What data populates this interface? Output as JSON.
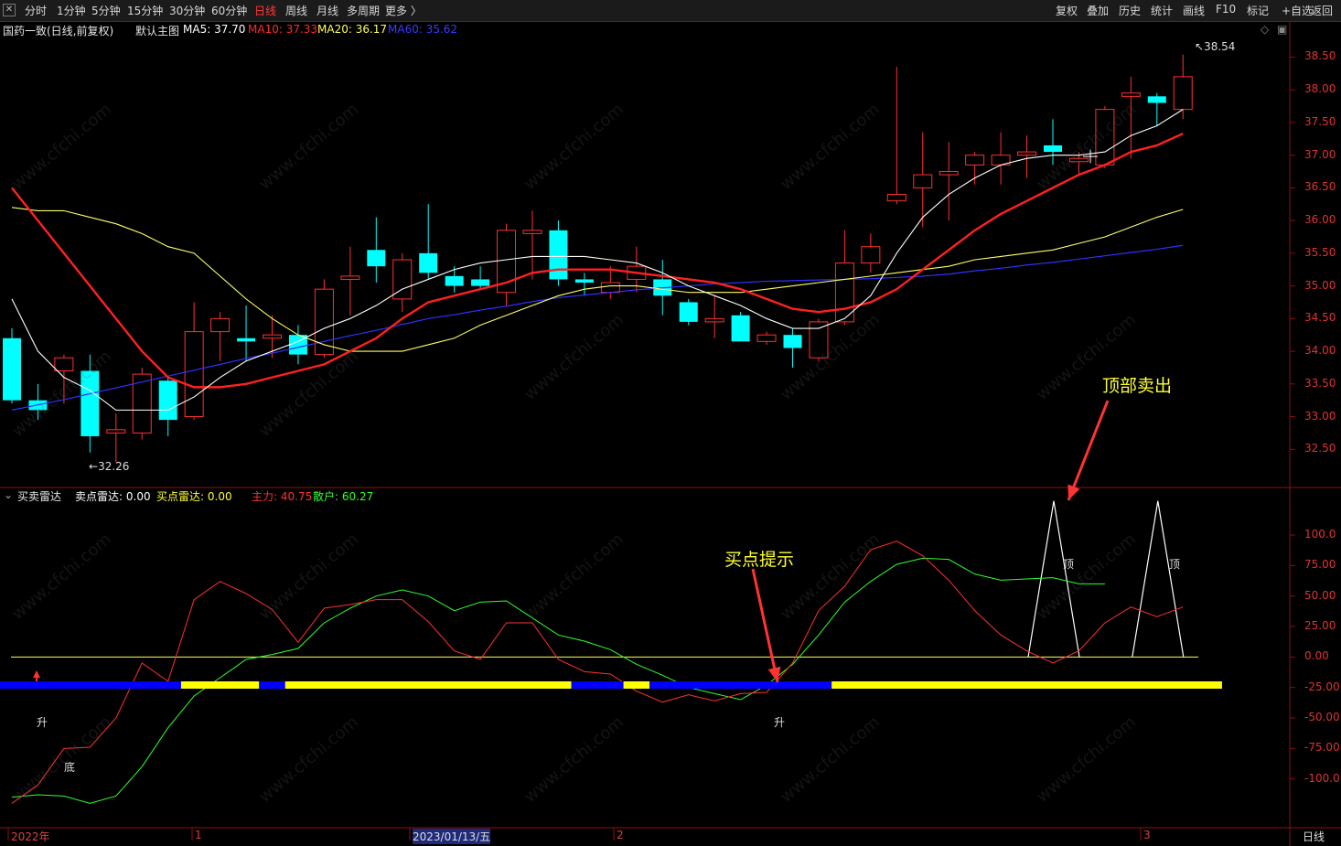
{
  "toolbar": {
    "left": [
      "分时",
      "1分钟",
      "5分钟",
      "15分钟",
      "30分钟",
      "60分钟",
      "日线",
      "周线",
      "月线",
      "多周期",
      "更多 〉"
    ],
    "active": "日线",
    "right": [
      "复权",
      "叠加",
      "历史",
      "统计",
      "画线",
      "F10",
      "标记",
      "+自选",
      "返回"
    ]
  },
  "main_header": {
    "title": "国药一致(日线,前复权)",
    "template": "默认主图",
    "ma5_label": "MA5:",
    "ma5_value": "37.70",
    "ma10_label": "MA10:",
    "ma10_value": "37.33",
    "ma20_label": "MA20:",
    "ma20_value": "36.17",
    "ma60_label": "MA60:",
    "ma60_value": "35.62"
  },
  "sub_header": {
    "title": "买卖雷达",
    "sell_label": "卖点雷达:",
    "sell_value": "0.00",
    "buy_label": "买点雷达:",
    "buy_value": "0.00",
    "main_label": "主力:",
    "main_value": "40.75",
    "retail_label": "散户:",
    "retail_value": "60.27"
  },
  "price_axis": [
    "38.50",
    "38.00",
    "37.50",
    "37.00",
    "36.50",
    "36.00",
    "35.50",
    "35.00",
    "34.50",
    "34.00",
    "33.50",
    "33.00",
    "32.50"
  ],
  "osc_axis": [
    "100.0",
    "75.00",
    "50.00",
    "25.00",
    "0.00",
    "-25.00",
    "-50.00",
    "-75.00",
    "-100.0"
  ],
  "x_axis": [
    "2022年",
    "1",
    "2023/01/13/五",
    "2",
    "3"
  ],
  "period_label": "日线",
  "marks": {
    "high": "38.54",
    "low": "32.26",
    "rise": "升",
    "bottom": "底",
    "top": "顶"
  },
  "annotations": {
    "buy_hint": "买点提示",
    "sell_hint": "顶部卖出"
  },
  "watermark": "www.cfchi.com",
  "colors": {
    "up": "#ff3030",
    "down": "#00ffff",
    "ma5": "#ffffff",
    "ma10": "#ff2020",
    "ma20": "#ffff66",
    "ma60": "#3030ff",
    "main": "#ff3030",
    "retail": "#30ff30",
    "buy_band": "#ffff00",
    "sell_band": "#0000ff",
    "annot": "#ffff33"
  },
  "chart_data": {
    "type": "candlestick",
    "candles": [
      {
        "o": 34.2,
        "h": 34.35,
        "l": 33.2,
        "c": 33.25
      },
      {
        "o": 33.25,
        "h": 33.5,
        "l": 32.95,
        "c": 33.1
      },
      {
        "o": 33.7,
        "h": 33.95,
        "l": 33.2,
        "c": 33.9
      },
      {
        "o": 33.7,
        "h": 33.95,
        "l": 32.45,
        "c": 32.7
      },
      {
        "o": 32.75,
        "h": 33.05,
        "l": 32.3,
        "c": 32.8
      },
      {
        "o": 32.75,
        "h": 33.75,
        "l": 32.65,
        "c": 33.65
      },
      {
        "o": 33.55,
        "h": 33.6,
        "l": 32.7,
        "c": 32.95
      },
      {
        "o": 33.0,
        "h": 34.75,
        "l": 32.95,
        "c": 34.3
      },
      {
        "o": 34.3,
        "h": 34.6,
        "l": 33.85,
        "c": 34.5
      },
      {
        "o": 34.2,
        "h": 34.7,
        "l": 33.85,
        "c": 34.15
      },
      {
        "o": 34.2,
        "h": 34.55,
        "l": 33.9,
        "c": 34.25
      },
      {
        "o": 34.25,
        "h": 34.4,
        "l": 33.8,
        "c": 33.95
      },
      {
        "o": 33.95,
        "h": 35.1,
        "l": 33.9,
        "c": 34.95
      },
      {
        "o": 35.1,
        "h": 35.6,
        "l": 34.55,
        "c": 35.15
      },
      {
        "o": 35.55,
        "h": 36.05,
        "l": 35.05,
        "c": 35.3
      },
      {
        "o": 34.8,
        "h": 35.5,
        "l": 34.6,
        "c": 35.4
      },
      {
        "o": 35.5,
        "h": 36.25,
        "l": 35.1,
        "c": 35.2
      },
      {
        "o": 35.15,
        "h": 35.3,
        "l": 34.9,
        "c": 35.0
      },
      {
        "o": 35.1,
        "h": 35.3,
        "l": 34.95,
        "c": 35.0
      },
      {
        "o": 34.9,
        "h": 35.95,
        "l": 34.7,
        "c": 35.85
      },
      {
        "o": 35.8,
        "h": 36.15,
        "l": 35.1,
        "c": 35.85
      },
      {
        "o": 35.85,
        "h": 36.0,
        "l": 35.0,
        "c": 35.1
      },
      {
        "o": 35.1,
        "h": 35.2,
        "l": 34.85,
        "c": 35.05
      },
      {
        "o": 34.9,
        "h": 35.3,
        "l": 34.8,
        "c": 35.05
      },
      {
        "o": 35.1,
        "h": 35.6,
        "l": 34.9,
        "c": 35.3
      },
      {
        "o": 35.1,
        "h": 35.4,
        "l": 34.55,
        "c": 34.85
      },
      {
        "o": 34.75,
        "h": 34.8,
        "l": 34.4,
        "c": 34.45
      },
      {
        "o": 34.45,
        "h": 34.85,
        "l": 34.2,
        "c": 34.5
      },
      {
        "o": 34.55,
        "h": 34.6,
        "l": 34.15,
        "c": 34.15
      },
      {
        "o": 34.15,
        "h": 34.3,
        "l": 34.1,
        "c": 34.25
      },
      {
        "o": 34.25,
        "h": 34.35,
        "l": 33.75,
        "c": 34.05
      },
      {
        "o": 33.9,
        "h": 34.5,
        "l": 33.85,
        "c": 34.45
      },
      {
        "o": 34.45,
        "h": 35.85,
        "l": 34.4,
        "c": 35.35
      },
      {
        "o": 35.35,
        "h": 35.8,
        "l": 35.2,
        "c": 35.6
      },
      {
        "o": 36.3,
        "h": 38.35,
        "l": 36.25,
        "c": 36.4
      },
      {
        "o": 36.5,
        "h": 37.35,
        "l": 35.9,
        "c": 36.7
      },
      {
        "o": 36.7,
        "h": 37.2,
        "l": 36.0,
        "c": 36.75
      },
      {
        "o": 36.85,
        "h": 37.05,
        "l": 36.55,
        "c": 37.0
      },
      {
        "o": 36.85,
        "h": 37.35,
        "l": 36.55,
        "c": 37.0
      },
      {
        "o": 37.0,
        "h": 37.3,
        "l": 36.65,
        "c": 37.05
      },
      {
        "o": 37.15,
        "h": 37.55,
        "l": 36.85,
        "c": 37.05
      },
      {
        "o": 36.9,
        "h": 37.05,
        "l": 36.7,
        "c": 36.95
      },
      {
        "o": 36.85,
        "h": 37.75,
        "l": 36.8,
        "c": 37.7
      },
      {
        "o": 37.9,
        "h": 38.2,
        "l": 36.95,
        "c": 37.95
      },
      {
        "o": 37.9,
        "h": 37.95,
        "l": 37.45,
        "c": 37.8
      },
      {
        "o": 37.7,
        "h": 38.54,
        "l": 37.55,
        "c": 38.2
      }
    ],
    "ma5": [
      34.8,
      34.0,
      33.6,
      33.4,
      33.1,
      33.1,
      33.1,
      33.3,
      33.6,
      33.85,
      34.0,
      34.15,
      34.35,
      34.5,
      34.7,
      34.95,
      35.1,
      35.25,
      35.35,
      35.4,
      35.45,
      35.45,
      35.45,
      35.4,
      35.35,
      35.2,
      35.0,
      34.85,
      34.7,
      34.5,
      34.35,
      34.35,
      34.5,
      34.85,
      35.5,
      36.05,
      36.4,
      36.65,
      36.85,
      36.95,
      37.0,
      37.0,
      37.05,
      37.3,
      37.45,
      37.7
    ],
    "ma10": [
      36.5,
      36.0,
      35.5,
      35.0,
      34.5,
      34.0,
      33.6,
      33.45,
      33.45,
      33.5,
      33.6,
      33.7,
      33.8,
      34.0,
      34.2,
      34.5,
      34.75,
      34.85,
      34.95,
      35.05,
      35.2,
      35.25,
      35.25,
      35.25,
      35.2,
      35.15,
      35.1,
      35.05,
      34.95,
      34.8,
      34.65,
      34.6,
      34.65,
      34.75,
      34.95,
      35.25,
      35.55,
      35.85,
      36.1,
      36.3,
      36.5,
      36.7,
      36.85,
      37.05,
      37.15,
      37.33
    ],
    "ma20": [
      36.2,
      36.15,
      36.15,
      36.05,
      35.95,
      35.8,
      35.6,
      35.5,
      35.15,
      34.8,
      34.5,
      34.25,
      34.1,
      34.0,
      34.0,
      34.0,
      34.1,
      34.2,
      34.4,
      34.55,
      34.7,
      34.85,
      34.95,
      35.0,
      35.0,
      34.95,
      34.9,
      34.9,
      34.9,
      34.95,
      35.0,
      35.05,
      35.1,
      35.15,
      35.2,
      35.25,
      35.3,
      35.4,
      35.45,
      35.5,
      35.55,
      35.65,
      35.75,
      35.9,
      36.05,
      36.17
    ],
    "ma60": [
      33.1,
      33.18,
      33.26,
      33.35,
      33.44,
      33.53,
      33.62,
      33.71,
      33.8,
      33.89,
      33.97,
      34.06,
      34.15,
      34.24,
      34.32,
      34.41,
      34.5,
      34.56,
      34.63,
      34.69,
      34.76,
      34.82,
      34.86,
      34.9,
      34.94,
      34.97,
      35.0,
      35.03,
      35.05,
      35.07,
      35.08,
      35.09,
      35.1,
      35.11,
      35.13,
      35.15,
      35.18,
      35.23,
      35.27,
      35.32,
      35.36,
      35.41,
      35.46,
      35.51,
      35.56,
      35.62
    ],
    "main_line": [
      -120,
      -105,
      -75,
      -74,
      -50,
      -5,
      -20,
      47,
      62,
      52,
      39,
      12,
      40,
      43,
      47,
      47,
      29,
      5,
      -2,
      28,
      28,
      -2,
      -12,
      -14,
      -28,
      -37,
      -31,
      -36,
      -30,
      -29,
      -5,
      38,
      58,
      88,
      95,
      83,
      63,
      38,
      18,
      5,
      -5,
      5,
      28,
      41,
      33,
      41
    ],
    "retail_line": [
      -115,
      -113,
      -114,
      -120,
      -114,
      -90,
      -58,
      -32,
      -17,
      -2,
      2,
      7,
      28,
      40,
      50,
      55,
      50,
      38,
      45,
      46,
      32,
      18,
      13,
      6,
      -6,
      -15,
      -25,
      -30,
      -35,
      -23,
      -6,
      18,
      45,
      62,
      76,
      81,
      80,
      68,
      63,
      64,
      65,
      60,
      60
    ],
    "top_signal_index": [
      40,
      44
    ],
    "buy_band_segments": [
      {
        "from": 0,
        "to": 6,
        "state": "sell"
      },
      {
        "from": 7,
        "to": 9,
        "state": "buy"
      },
      {
        "from": 10,
        "to": 10,
        "state": "sell"
      },
      {
        "from": 11,
        "to": 21,
        "state": "buy"
      },
      {
        "from": 22,
        "to": 23,
        "state": "sell"
      },
      {
        "from": 24,
        "to": 24,
        "state": "buy"
      },
      {
        "from": 25,
        "to": 31,
        "state": "sell"
      },
      {
        "from": 32,
        "to": 46,
        "state": "buy"
      }
    ],
    "ylim": [
      32.0,
      38.8
    ],
    "osc_ylim": [
      -140,
      130
    ]
  }
}
